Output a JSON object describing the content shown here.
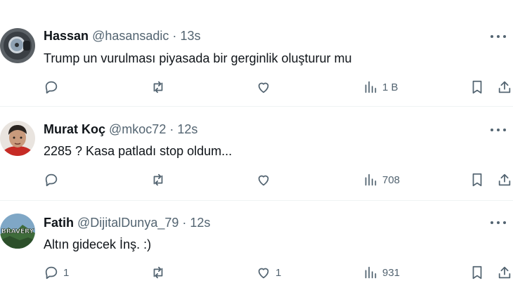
{
  "tweets": [
    {
      "name": "Hassan",
      "handle": "@hasansadic",
      "separator": "·",
      "time": "13s",
      "text": "Trump un vurulması piyasada bir gerginlik oluşturur mu",
      "reply_count": "",
      "retweet_count": "",
      "like_count": "",
      "views": "1 B"
    },
    {
      "name": "Murat Koç",
      "handle": "@mkoc72",
      "separator": "·",
      "time": "12s",
      "text": "2285 ? Kasa patladı stop oldum...",
      "reply_count": "",
      "retweet_count": "",
      "like_count": "",
      "views": "708"
    },
    {
      "name": "Fatih",
      "handle": "@DijitalDunya_79",
      "separator": "·",
      "time": "12s",
      "text": "Altın gidecek İnş. :)",
      "avatar_text": "BRAVERY",
      "reply_count": "1",
      "retweet_count": "",
      "like_count": "1",
      "views": "931"
    }
  ],
  "colors": {
    "text_primary": "#0f1419",
    "text_secondary": "#536471",
    "divider": "#eff3f4"
  },
  "icons": [
    "reply-icon",
    "retweet-icon",
    "like-icon",
    "views-icon",
    "bookmark-icon",
    "share-icon",
    "more-icon"
  ]
}
